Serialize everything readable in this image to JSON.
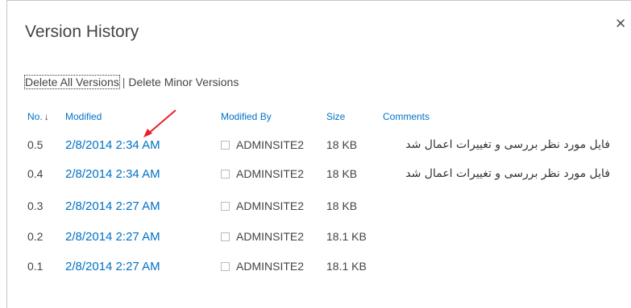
{
  "dialog": {
    "title": "Version History",
    "close_label": "✕",
    "actions": {
      "delete_all": "Delete All Versions",
      "separator": "|",
      "delete_minor": "Delete Minor Versions"
    }
  },
  "table": {
    "columns": {
      "no": "No.",
      "modified": "Modified",
      "modified_by": "Modified By",
      "size": "Size",
      "comments": "Comments"
    },
    "sort_indicator": "↓",
    "rows": [
      {
        "no": "0.5",
        "modified": "2/8/2014 2:34 AM",
        "modified_by": "ADMINSITE2",
        "size": "18 KB",
        "comment": "فایل مورد نظر بررسی و تغییرات اعمال شد"
      },
      {
        "no": "0.4",
        "modified": "2/8/2014 2:34 AM",
        "modified_by": "ADMINSITE2",
        "size": "18 KB",
        "comment": "فایل مورد نظر بررسی و تغییرات اعمال شد"
      },
      {
        "no": "0.3",
        "modified": "2/8/2014 2:27 AM",
        "modified_by": "ADMINSITE2",
        "size": "18 KB",
        "comment": ""
      },
      {
        "no": "0.2",
        "modified": "2/8/2014 2:27 AM",
        "modified_by": "ADMINSITE2",
        "size": "18.1 KB",
        "comment": ""
      },
      {
        "no": "0.1",
        "modified": "2/8/2014 2:27 AM",
        "modified_by": "ADMINSITE2",
        "size": "18.1 KB",
        "comment": ""
      }
    ]
  },
  "colors": {
    "link": "#0072c6",
    "annotation_arrow": "#e8202a"
  }
}
